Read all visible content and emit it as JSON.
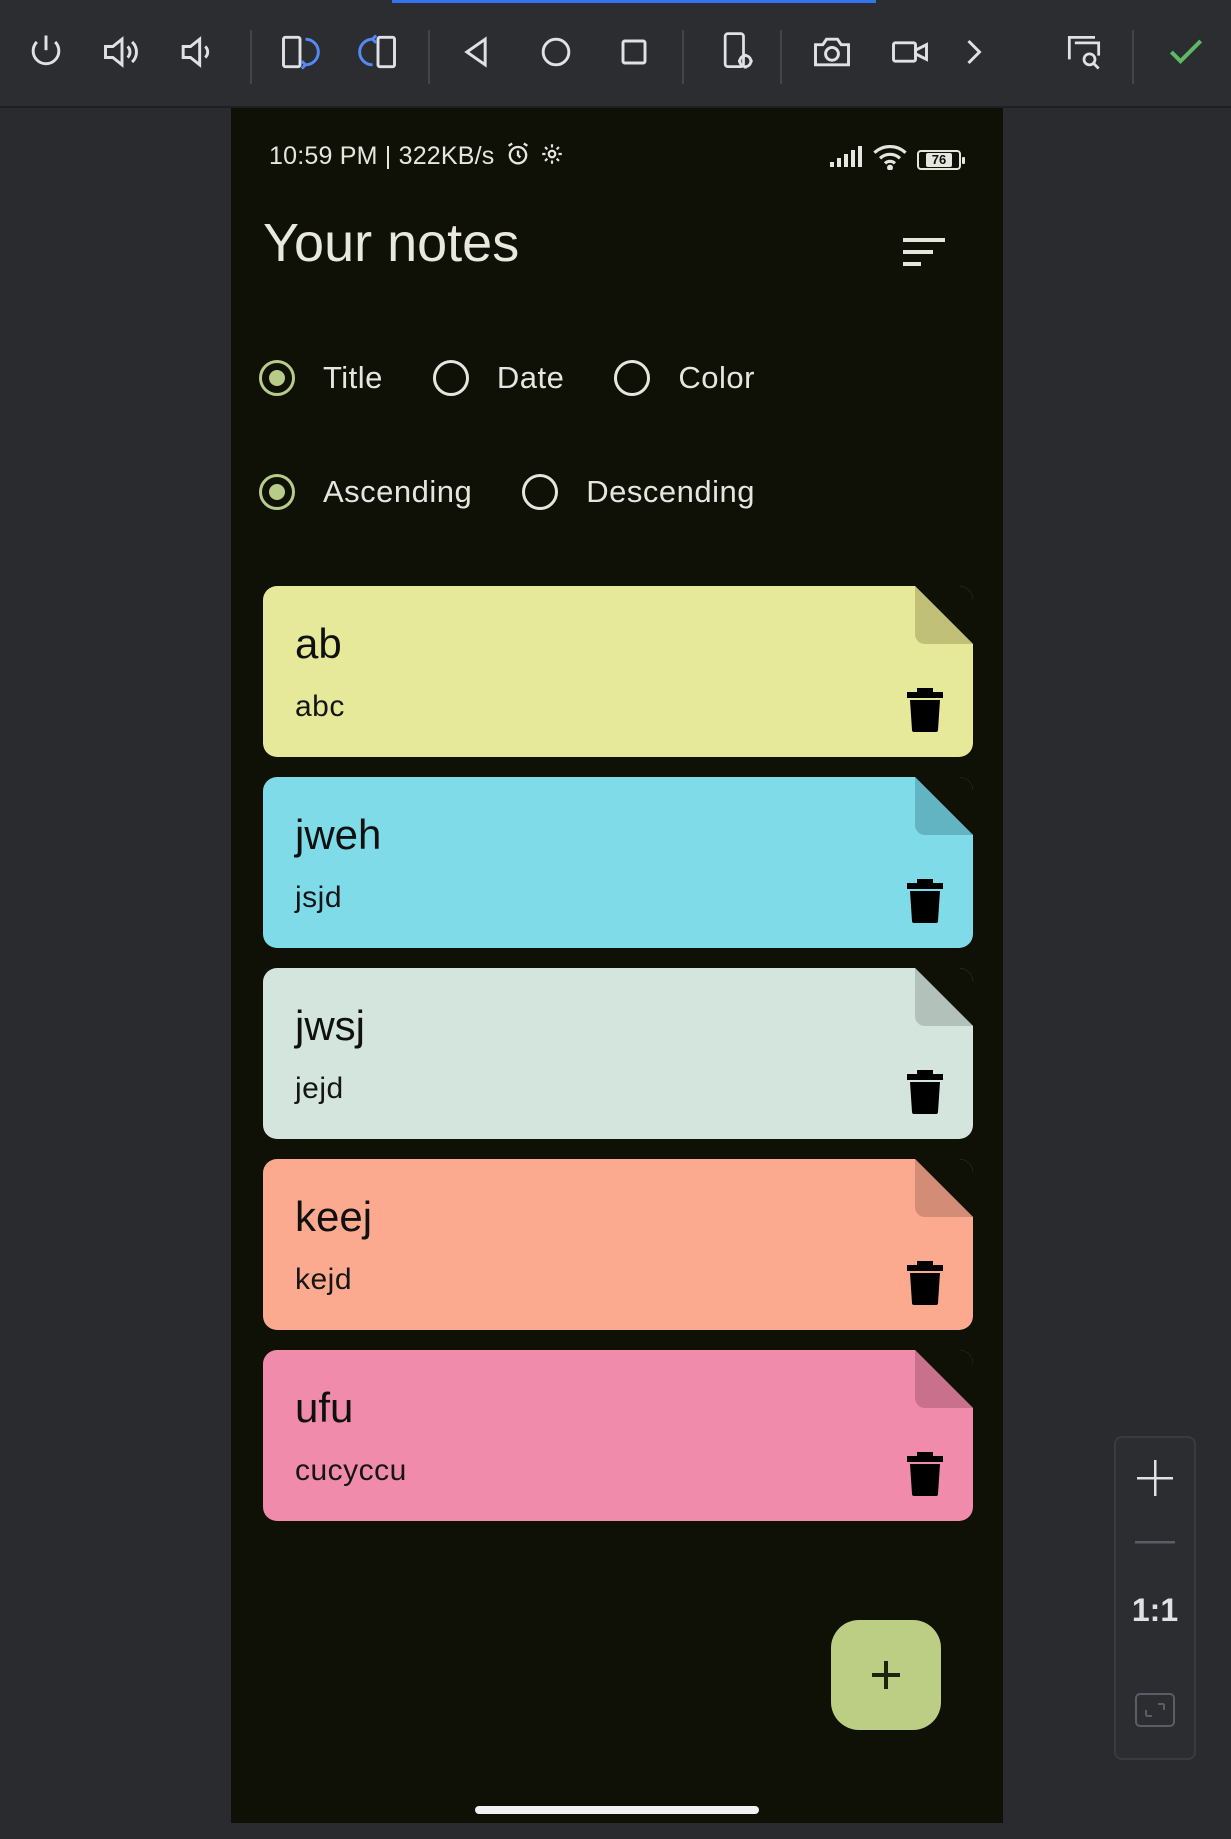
{
  "toolbar": {
    "buttons": [
      {
        "name": "power-icon"
      },
      {
        "name": "volume-up-icon"
      },
      {
        "name": "volume-down-icon"
      },
      {
        "name": "rotate-left-icon"
      },
      {
        "name": "rotate-right-icon"
      },
      {
        "name": "back-icon"
      },
      {
        "name": "home-icon"
      },
      {
        "name": "overview-icon"
      },
      {
        "name": "device-settings-icon"
      },
      {
        "name": "camera-icon"
      },
      {
        "name": "video-icon"
      },
      {
        "name": "chevron-right-icon"
      },
      {
        "name": "inspect-icon"
      },
      {
        "name": "check-icon"
      }
    ],
    "colors": {
      "icon": "#dfe1e5",
      "active": "#548af7",
      "check": "#5fb865"
    }
  },
  "status_bar": {
    "text": "10:59 PM | 322KB/s",
    "battery": "76"
  },
  "header": {
    "title": "Your notes"
  },
  "sort": {
    "order_by": [
      {
        "label": "Title",
        "checked": true
      },
      {
        "label": "Date",
        "checked": false
      },
      {
        "label": "Color",
        "checked": false
      }
    ],
    "direction": [
      {
        "label": "Ascending",
        "checked": true
      },
      {
        "label": "Descending",
        "checked": false
      }
    ]
  },
  "notes": [
    {
      "title": "ab",
      "body": "abc",
      "color": "#e6e999",
      "fold": "#c0c078"
    },
    {
      "title": "jweh",
      "body": "jsjd",
      "color": "#7fdbe8",
      "fold": "#63b4c2"
    },
    {
      "title": "jwsj",
      "body": "jejd",
      "color": "#d4e5dd",
      "fold": "#b2c2ba"
    },
    {
      "title": "keej",
      "body": "kejd",
      "color": "#fbaa90",
      "fold": "#d38c75"
    },
    {
      "title": "ufu",
      "body": "cucyccu",
      "color": "#f08bac",
      "fold": "#c9708d"
    }
  ],
  "fab": {
    "label": "+"
  },
  "zoom": {
    "one_to_one": "1:1"
  }
}
